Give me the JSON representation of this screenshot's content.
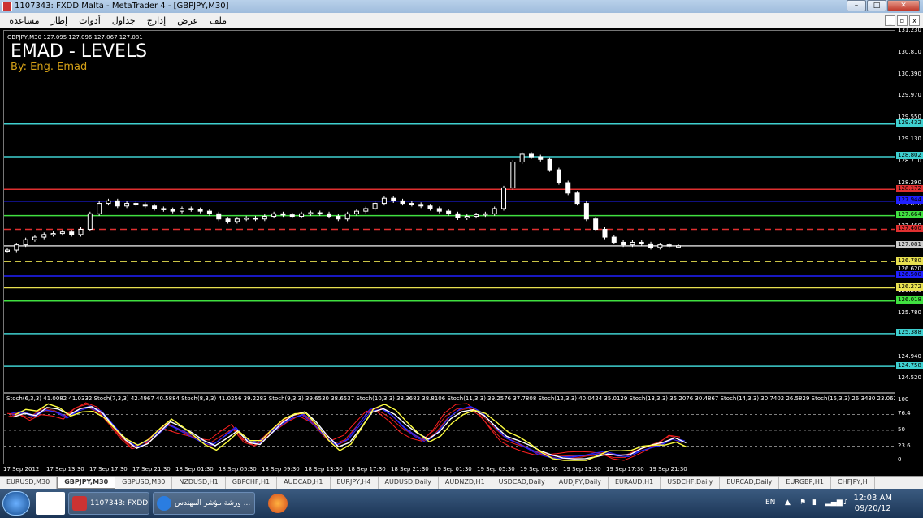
{
  "window": {
    "title": "1107343: FXDD Malta - MetaTrader 4 - [GBPJPY,M30]"
  },
  "menu": {
    "items": [
      "ملف",
      "عرض",
      "إدارج",
      "جداول",
      "أدوات",
      "إطار",
      "مساعدة"
    ]
  },
  "chart": {
    "header": "GBPJPY,M30  127.095 127.096 127.067 127.081",
    "title": "EMAD - LEVELS",
    "author": "By: Eng. Emad",
    "price_range": [
      124.4,
      131.23
    ],
    "price_ticks": [
      "131.230",
      "130.810",
      "130.390",
      "129.970",
      "129.550",
      "129.130",
      "128.710",
      "128.290",
      "127.870",
      "127.460",
      "127.081",
      "126.620",
      "126.200",
      "125.780",
      "125.360",
      "124.940",
      "124.520"
    ],
    "levels": [
      {
        "price": 129.432,
        "label": "129.432",
        "color": "#3fd0d0",
        "style": "solid"
      },
      {
        "price": 128.802,
        "label": "128.802",
        "color": "#3fd0d0",
        "style": "solid"
      },
      {
        "price": 128.172,
        "label": "128.172",
        "color": "#e03030",
        "style": "solid"
      },
      {
        "price": 127.944,
        "label": "127.944",
        "color": "#2020ff",
        "style": "solid"
      },
      {
        "price": 127.664,
        "label": "127.664",
        "color": "#40e040",
        "style": "solid"
      },
      {
        "price": 127.4,
        "label": "127.400",
        "color": "#e03030",
        "style": "dash"
      },
      {
        "price": 127.081,
        "label": "127.081",
        "color": "#cccccc",
        "style": "solid"
      },
      {
        "price": 126.78,
        "label": "126.780",
        "color": "#e8e050",
        "style": "dash"
      },
      {
        "price": 126.5,
        "label": "126.500",
        "color": "#2020ff",
        "style": "solid"
      },
      {
        "price": 126.272,
        "label": "126.272",
        "color": "#e8e050",
        "style": "solid"
      },
      {
        "price": 126.018,
        "label": "126.018",
        "color": "#40e040",
        "style": "solid"
      },
      {
        "price": 125.388,
        "label": "125.388",
        "color": "#3fd0d0",
        "style": "solid"
      },
      {
        "price": 124.758,
        "label": "124.758",
        "color": "#3fd0d0",
        "style": "solid"
      }
    ],
    "closes": [
      127.0,
      127.1,
      127.2,
      127.25,
      127.3,
      127.32,
      127.35,
      127.3,
      127.4,
      127.7,
      127.9,
      127.95,
      127.85,
      127.9,
      127.88,
      127.85,
      127.8,
      127.78,
      127.75,
      127.8,
      127.78,
      127.75,
      127.7,
      127.6,
      127.55,
      127.6,
      127.62,
      127.6,
      127.65,
      127.7,
      127.68,
      127.65,
      127.7,
      127.72,
      127.7,
      127.65,
      127.6,
      127.7,
      127.75,
      127.8,
      127.9,
      128.0,
      127.95,
      127.9,
      127.88,
      127.85,
      127.8,
      127.75,
      127.7,
      127.62,
      127.65,
      127.68,
      127.7,
      127.8,
      128.2,
      128.7,
      128.85,
      128.8,
      128.75,
      128.55,
      128.3,
      128.1,
      127.9,
      127.6,
      127.4,
      127.25,
      127.15,
      127.1,
      127.15,
      127.12,
      127.05,
      127.1,
      127.08,
      127.081
    ]
  },
  "oscillator": {
    "title": "Stoch(6,3,3) 41.0082 41.0332  Stoch(7,3,3) 42.4967 40.5884  Stoch(8,3,3) 41.0256 39.2283  Stoch(9,3,3) 39.6530 38.6537  Stoch(10,3,3) 38.3683 38.8106  Stoch(11,3,3) 39.2576 37.7808  Stoch(12,3,3) 40.0424 35.0129  Stoch(13,3,3) 35.2076 30.4867  Stoch(14,3,3) 30.7402 26.5829  Stoch(15,3,3) 26.3430 23.0625  S",
    "ticks": [
      "100",
      "76.4",
      "50",
      "23.6",
      "0"
    ],
    "values": [
      78,
      82,
      75,
      85,
      80,
      70,
      82,
      88,
      80,
      60,
      40,
      25,
      30,
      45,
      60,
      50,
      40,
      30,
      25,
      40,
      55,
      35,
      30,
      45,
      60,
      70,
      75,
      60,
      40,
      25,
      35,
      60,
      85,
      88,
      75,
      55,
      40,
      30,
      45,
      70,
      85,
      90,
      80,
      60,
      40,
      30,
      20,
      10,
      5,
      3,
      5,
      8,
      12,
      15,
      10,
      8,
      15,
      20,
      25,
      35,
      30
    ]
  },
  "time_axis": [
    "17 Sep 2012",
    "17 Sep 13:30",
    "17 Sep 17:30",
    "17 Sep 21:30",
    "18 Sep 01:30",
    "18 Sep 05:30",
    "18 Sep 09:30",
    "18 Sep 13:30",
    "18 Sep 17:30",
    "18 Sep 21:30",
    "19 Sep 01:30",
    "19 Sep 05:30",
    "19 Sep 09:30",
    "19 Sep 13:30",
    "19 Sep 17:30",
    "19 Sep 21:30"
  ],
  "tabs": [
    "EURUSD,M30",
    "GBPJPY,M30",
    "GBPUSD,M30",
    "NZDUSD,H1",
    "GBPCHF,H1",
    "AUDCAD,H1",
    "EURJPY,H4",
    "AUDUSD,Daily",
    "AUDNZD,H1",
    "USDCAD,Daily",
    "AUDJPY,Daily",
    "EURAUD,H1",
    "USDCHF,Daily",
    "EURCAD,Daily",
    "EURGBP,H1",
    "CHFJPY,H"
  ],
  "active_tab": "GBPJPY,M30",
  "taskbar": {
    "task1": "1107343: FXDD M...",
    "task2": "ورشة مؤشر المهندس ...",
    "lang": "EN",
    "time": "12:03 AM",
    "date": "09/20/12"
  }
}
